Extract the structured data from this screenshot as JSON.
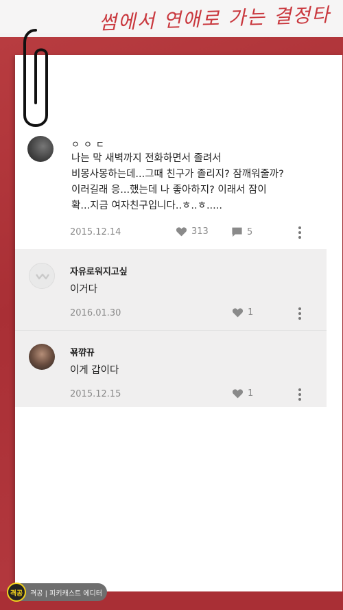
{
  "header": {
    "title": "썸에서 연애로 가는 결정타"
  },
  "post": {
    "author": "ㅇㅇㄷ",
    "text": "나는 막 새벽까지 전화하면서 졸려서\n비몽사몽하는데...그때 친구가 졸리지? 잠깨워줄까?\n이러길래 응...했는데 나 좋아하지? 이래서 잠이\n확...지금 여자친구입니다..ㅎ..ㅎ.....",
    "date": "2015.12.14",
    "likes": "313",
    "comments": "5"
  },
  "replies": [
    {
      "author": "자유로워지고싶",
      "text": "이거다",
      "date": "2016.01.30",
      "likes": "1"
    },
    {
      "author": "꾞꺆뀨",
      "text": "이게 갑이다",
      "date": "2015.12.15",
      "likes": "1"
    }
  ],
  "footer": {
    "logo_text": "격공",
    "editor_label": "격공 | 피키캐스트 에디터"
  },
  "colors": {
    "accent": "#c9373d",
    "paper": "#ffffff",
    "background_red": "#b0353a"
  },
  "icons": {
    "like": "heart-icon",
    "comment": "speech-bubble-icon",
    "more": "kebab-menu-icon",
    "clip": "paperclip-icon"
  }
}
